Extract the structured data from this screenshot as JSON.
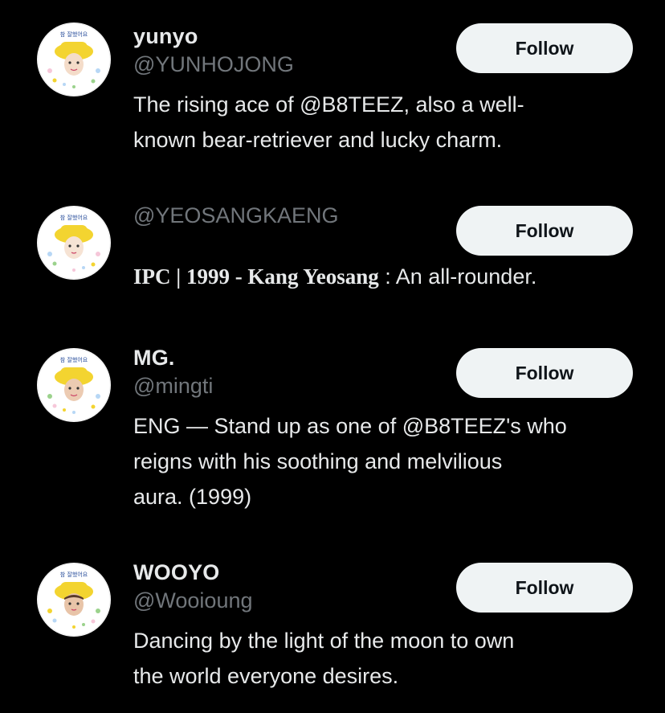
{
  "accounts": [
    {
      "name": "yunyo",
      "handle": "@YUNHOJONG",
      "bio": "The rising ace of @B8TEEZ, also a well-known bear-retriever and lucky charm.",
      "bio_lines": [
        "The rising ace of @B8TEEZ, also a well-",
        "known bear-retriever and lucky charm."
      ],
      "follow_label": "Follow",
      "avatar_caption": "참 잘했어요"
    },
    {
      "name": "",
      "handle": "@YEOSANGKAENG",
      "bio_serif": "IPC | 1999 - Kang Yeosang",
      "bio_plain": " : An all-rounder.",
      "follow_label": "Follow",
      "avatar_caption": "참 잘했어요"
    },
    {
      "name": "MG.",
      "handle": "@mingti",
      "bio": "ENG — Stand up as one of @B8TEEZ's who reigns with his soothing and melvilious aura. (1999)",
      "bio_lines": [
        "ENG — Stand up as one of @B8TEEZ's who",
        "reigns with his soothing and melvilious",
        "aura. (1999)"
      ],
      "follow_label": "Follow",
      "avatar_caption": "참 잘했어요"
    },
    {
      "name": "WOOYO",
      "handle": "@Wooioung",
      "bio": "Dancing by the light of the moon to own the world everyone desires.",
      "bio_lines": [
        "Dancing by the light of the moon to own",
        "the world everyone desires."
      ],
      "follow_label": "Follow",
      "avatar_caption": "참 잘했어요"
    }
  ],
  "colors": {
    "background": "#000000",
    "primary_text": "#e7e9ea",
    "secondary_text": "#71767b",
    "button_bg": "#eff3f4",
    "button_text": "#0f1419",
    "hat_yellow": "#f3d430"
  }
}
